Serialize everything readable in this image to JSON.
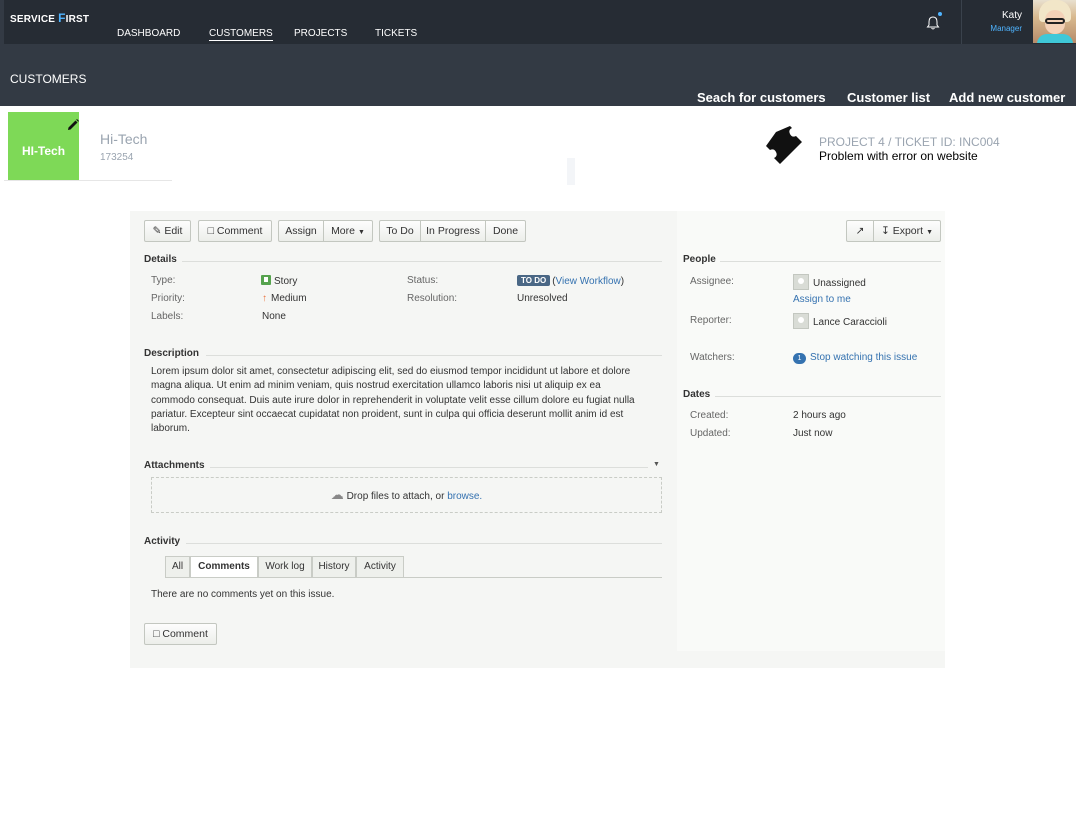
{
  "app": {
    "brand_a": "SERVICE ",
    "brand_b": "F",
    "brand_c": "IRST"
  },
  "nav": {
    "items": [
      "DASHBOARD",
      "CUSTOMERS",
      "PROJECTS",
      "TICKETS"
    ],
    "active": "CUSTOMERS"
  },
  "user": {
    "name": "Katy",
    "role": "Manager"
  },
  "header": {
    "section_title": "CUSTOMERS",
    "actions": [
      "Seach for customers",
      "Customer list",
      "Add new customer"
    ]
  },
  "customer": {
    "logo_text": "HI-Tech",
    "name": "Hi-Tech",
    "id": "173254"
  },
  "ticket": {
    "meta": "PROJECT 4  / TICKET ID: INC004",
    "title": "Problem with error on website"
  },
  "issue": {
    "toolbar": {
      "edit": "Edit",
      "comment": "Comment",
      "assign": "Assign",
      "more": "More",
      "todo": "To Do",
      "in_progress": "In Progress",
      "done": "Done",
      "export": "Export"
    },
    "details": {
      "heading": "Details",
      "type_label": "Type:",
      "type_value": "Story",
      "priority_label": "Priority:",
      "priority_value": "Medium",
      "labels_label": "Labels:",
      "labels_value": "None",
      "status_label": "Status:",
      "status_lozenge": "TO DO",
      "status_paren_open": "(",
      "status_link": "View Workflow",
      "status_paren_close": ")",
      "resolution_label": "Resolution:",
      "resolution_value": "Unresolved"
    },
    "description": {
      "heading": "Description",
      "text": "Lorem ipsum dolor sit amet, consectetur adipiscing elit, sed do eiusmod tempor incididunt ut labore et dolore magna aliqua. Ut enim ad minim veniam, quis nostrud exercitation ullamco laboris nisi ut aliquip ex ea commodo consequat. Duis aute irure dolor in reprehenderit in voluptate velit esse cillum dolore eu fugiat nulla pariatur. Excepteur sint occaecat cupidatat non proident, sunt in culpa qui officia deserunt mollit anim id est laborum."
    },
    "attachments": {
      "heading": "Attachments",
      "drop_text": "Drop files to attach, or ",
      "browse": "browse."
    },
    "activity": {
      "heading": "Activity",
      "tabs": [
        "All",
        "Comments",
        "Work log",
        "History",
        "Activity"
      ],
      "active_tab": "Comments",
      "empty_text": "There are no comments yet on this issue.",
      "comment_button": "Comment"
    },
    "people": {
      "heading": "People",
      "assignee_label": "Assignee:",
      "assignee_value": "Unassigned",
      "assign_to_me": "Assign to me",
      "reporter_label": "Reporter:",
      "reporter_value": "Lance Caraccioli",
      "watchers_label": "Watchers:",
      "watchers_count": "1",
      "watchers_link": "Stop watching this issue"
    },
    "dates": {
      "heading": "Dates",
      "created_label": "Created:",
      "created_value": "2 hours ago",
      "updated_label": "Updated:",
      "updated_value": "Just now"
    }
  }
}
